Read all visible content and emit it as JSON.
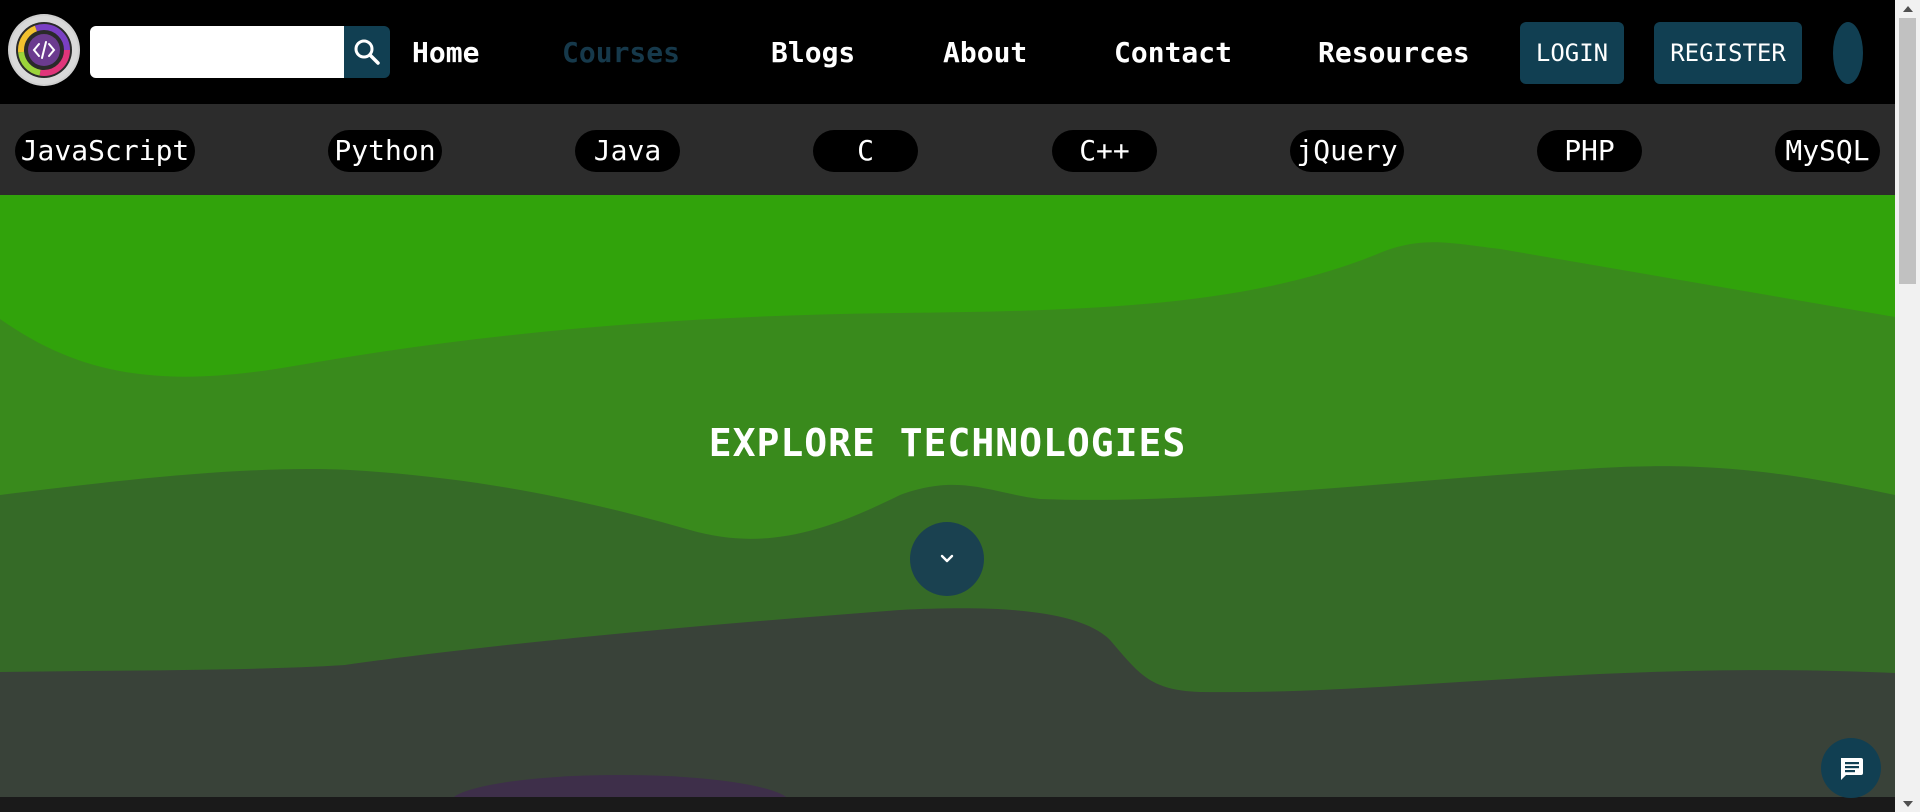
{
  "header": {
    "search": {
      "value": "",
      "placeholder": ""
    },
    "nav": [
      {
        "label": "Home"
      },
      {
        "label": "Courses",
        "active": true
      },
      {
        "label": "Blogs"
      },
      {
        "label": "About"
      },
      {
        "label": "Contact"
      },
      {
        "label": "Resources"
      }
    ],
    "login_label": "LOGIN",
    "register_label": "REGISTER"
  },
  "tech_strip": {
    "items": [
      {
        "label": "JavaScript"
      },
      {
        "label": "Python"
      },
      {
        "label": "Java"
      },
      {
        "label": "C"
      },
      {
        "label": "C++"
      },
      {
        "label": "jQuery"
      },
      {
        "label": "PHP"
      },
      {
        "label": "MySQL"
      }
    ]
  },
  "hero": {
    "title": "EXPLORE TECHNOLOGIES"
  },
  "icons": {
    "logo": "code-brackets-logo",
    "search": "search-icon",
    "scroll_down": "chevron-down-icon",
    "chat": "chat-bubble-icon"
  },
  "colors": {
    "accent": "#113f52",
    "active_nav": "#16394b",
    "header_bg": "#000000",
    "strip_bg": "#2c2c2c",
    "wave_light_green": "#31a30b",
    "wave_green": "#398a1c",
    "wave_dark_green": "#356a27",
    "wave_grey": "#394239"
  }
}
